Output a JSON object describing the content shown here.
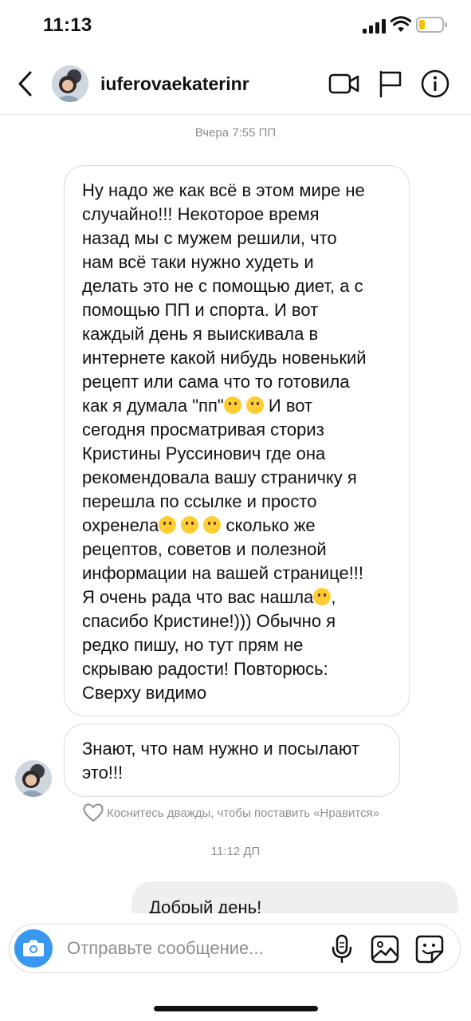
{
  "status_bar": {
    "time": "11:13"
  },
  "header": {
    "username": "iuferovaekaterinr"
  },
  "chat": {
    "timestamp_1": "Вчера 7:55 ПП",
    "message_1": {
      "part_1": "Ну надо же как всё в этом мире не\nслучайно!!! Некоторое время\nназад мы с мужем решили, что\nнам всё таки нужно худеть и\nделать это не с помощью диет, а с\nпомощью ПП и спорта. И вот\nкаждый день я выискивала в\nинтернете какой нибудь новенький\nрецепт или сама что то готовила\nкак я думала \"пп\"",
      "part_2": " И вот\nсегодня просматривая сториз\nКристины Руссинович где она\nрекомендовала вашу  страничку я\nперешла по ссылке и просто\nохренела",
      "part_3": " сколько же\nрецептов, советов и полезной\nинформации на вашей странице!!!\nЯ очень рада что вас нашла",
      "part_4": ",\nспасибо Кристине!))) Обычно я\nредко пишу, но тут прям не\nскрываю радости! Повторюсь:\nСверху видимо"
    },
    "message_2": "Знают, что нам нужно и посылают\nэто!!!",
    "like_hint": "Коснитесь дважды, чтобы поставить «Нравится»",
    "timestamp_2": "11:12 ДП",
    "message_3": "Добрый день!"
  },
  "composer": {
    "placeholder": "Отправьте сообщение..."
  },
  "colors": {
    "accent": "#3897f0",
    "bubble_border": "#dbdbdb",
    "outgoing_bubble": "#efefef",
    "muted_text": "#8e8e8e"
  },
  "icons": [
    "back-icon",
    "video-call-icon",
    "flag-icon",
    "info-icon",
    "heart-icon",
    "camera-icon",
    "microphone-icon",
    "gallery-icon",
    "sticker-icon"
  ]
}
